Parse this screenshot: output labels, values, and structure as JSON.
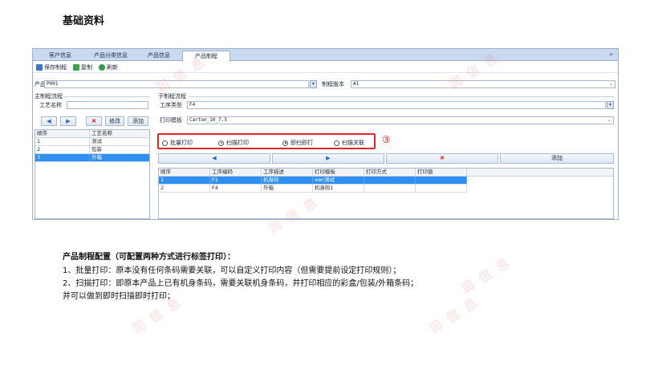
{
  "page": {
    "title": "基础资料"
  },
  "tabs": [
    {
      "label": "客户信息",
      "active": false
    },
    {
      "label": "产品分类信息",
      "active": false
    },
    {
      "label": "产品信息",
      "active": false
    },
    {
      "label": "产品制程",
      "active": true
    }
  ],
  "tab_collapse_glyph": "»",
  "toolbar": {
    "save": "保存制程",
    "copy": "复制",
    "refresh": "刷新"
  },
  "product_row": {
    "product_label": "产品",
    "product_value": "P001",
    "version_label": "制程版本",
    "version_value": "A1"
  },
  "left_panel": {
    "group_title": "主制程流程",
    "craft_label": "工艺名称",
    "craft_value": "",
    "buttons": {
      "prev": "◀",
      "next": "▶",
      "delete": "✖",
      "edit": "修改",
      "add": "添加"
    },
    "grid": {
      "columns": [
        "顺序",
        "工艺名称"
      ],
      "rows": [
        {
          "order": "1",
          "name": "测试",
          "selected": false
        },
        {
          "order": "2",
          "name": "包装",
          "selected": false
        },
        {
          "order": "3",
          "name": "外箱",
          "selected": true
        }
      ]
    }
  },
  "right_panel": {
    "group_title": "子制程流程",
    "process_type_label": "工序类型",
    "process_type_value": "F4",
    "template_label": "打印模板",
    "template_value": "Carton_10_7.5",
    "radios": [
      {
        "label": "批量打印",
        "checked": false
      },
      {
        "label": "扫描打印",
        "checked": true
      },
      {
        "label": "即扫即打",
        "checked": true
      },
      {
        "label": "扫描关联",
        "checked": false
      }
    ],
    "annotation": "③",
    "actions": {
      "prev": "◀",
      "next": "▶",
      "delete": "✖",
      "add": "添加"
    },
    "grid": {
      "columns": [
        "顺序",
        "工序编码",
        "工序描述",
        "打印模板",
        "打印方式",
        "打印值"
      ],
      "rows": [
        {
          "order": "1",
          "code": "F1",
          "desc": "机身码",
          "template": "ewr测试",
          "method": "",
          "value": "",
          "selected": true
        },
        {
          "order": "2",
          "code": "F4",
          "desc": "外箱",
          "template": "机身码1",
          "method": "",
          "value": "",
          "selected": false
        }
      ]
    }
  },
  "description": {
    "title": "产品制程配置（可配置两种方式进行标签打印）：",
    "lines": [
      "1、批量打印：原本没有任何条码需要关联，可以自定义打印内容（但需要提前设定打印规则）；",
      "2、扫描打印：即原本产品上已有机身条码，需要关联机身条码，并打印相应的彩盒/包装/外箱条码；",
      "并可以做到即时扫描即时打印；"
    ]
  },
  "watermark": "润 信 息",
  "colors": {
    "highlight_box": "#e0262b",
    "selected_row": "#2f8ff0",
    "tab_bar": "#c8d9f0"
  }
}
